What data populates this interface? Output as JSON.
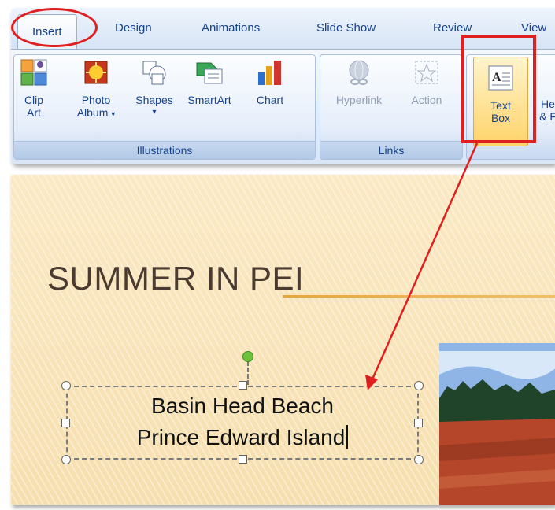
{
  "ribbon": {
    "tabs": [
      "Insert",
      "Design",
      "Animations",
      "Slide Show",
      "Review",
      "View"
    ],
    "active_tab": "Insert",
    "groups": {
      "illustrations": {
        "label": "Illustrations",
        "buttons": {
          "clip_art": [
            "Clip",
            "Art"
          ],
          "photo_album": [
            "Photo",
            "Album"
          ],
          "shapes": "Shapes",
          "smartart": "SmartArt",
          "chart": "Chart"
        }
      },
      "links": {
        "label": "Links",
        "buttons": {
          "hyperlink": "Hyperlink",
          "action": "Action"
        }
      },
      "text": {
        "buttons": {
          "text_box": [
            "Text",
            "Box"
          ],
          "header_footer_partial": [
            "He",
            "& F"
          ]
        }
      }
    }
  },
  "slide": {
    "title": "SUMMER IN PEI",
    "textbox_lines": [
      "Basin Head Beach",
      "Prince Edward Island"
    ]
  },
  "colors": {
    "highlight_red": "#e02020",
    "ribbon_text": "#15428b",
    "slide_bg": "#f8e4b8",
    "title_text": "#4a3a2f",
    "rotation_handle": "#6dc23b"
  },
  "icons": [
    "clip-art-icon",
    "photo-album-icon",
    "shapes-icon",
    "smartart-icon",
    "chart-icon",
    "hyperlink-icon",
    "action-icon",
    "text-box-icon"
  ]
}
